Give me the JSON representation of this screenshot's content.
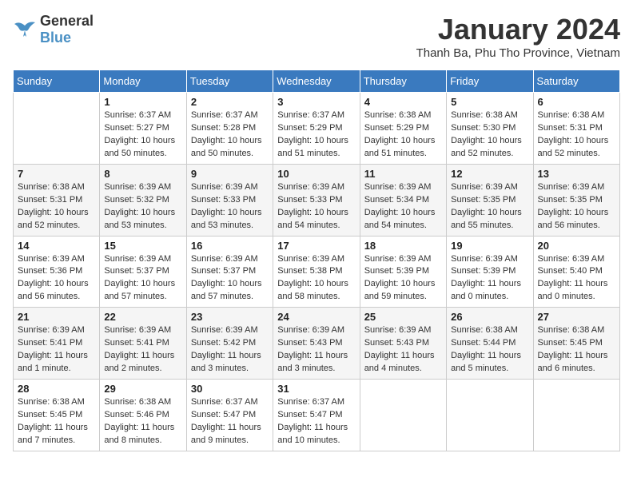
{
  "header": {
    "logo_line1": "General",
    "logo_line2": "Blue",
    "month": "January 2024",
    "location": "Thanh Ba, Phu Tho Province, Vietnam"
  },
  "weekdays": [
    "Sunday",
    "Monday",
    "Tuesday",
    "Wednesday",
    "Thursday",
    "Friday",
    "Saturday"
  ],
  "weeks": [
    [
      {
        "day": "",
        "text": ""
      },
      {
        "day": "1",
        "text": "Sunrise: 6:37 AM\nSunset: 5:27 PM\nDaylight: 10 hours\nand 50 minutes."
      },
      {
        "day": "2",
        "text": "Sunrise: 6:37 AM\nSunset: 5:28 PM\nDaylight: 10 hours\nand 50 minutes."
      },
      {
        "day": "3",
        "text": "Sunrise: 6:37 AM\nSunset: 5:29 PM\nDaylight: 10 hours\nand 51 minutes."
      },
      {
        "day": "4",
        "text": "Sunrise: 6:38 AM\nSunset: 5:29 PM\nDaylight: 10 hours\nand 51 minutes."
      },
      {
        "day": "5",
        "text": "Sunrise: 6:38 AM\nSunset: 5:30 PM\nDaylight: 10 hours\nand 52 minutes."
      },
      {
        "day": "6",
        "text": "Sunrise: 6:38 AM\nSunset: 5:31 PM\nDaylight: 10 hours\nand 52 minutes."
      }
    ],
    [
      {
        "day": "7",
        "text": "Sunrise: 6:38 AM\nSunset: 5:31 PM\nDaylight: 10 hours\nand 52 minutes."
      },
      {
        "day": "8",
        "text": "Sunrise: 6:39 AM\nSunset: 5:32 PM\nDaylight: 10 hours\nand 53 minutes."
      },
      {
        "day": "9",
        "text": "Sunrise: 6:39 AM\nSunset: 5:33 PM\nDaylight: 10 hours\nand 53 minutes."
      },
      {
        "day": "10",
        "text": "Sunrise: 6:39 AM\nSunset: 5:33 PM\nDaylight: 10 hours\nand 54 minutes."
      },
      {
        "day": "11",
        "text": "Sunrise: 6:39 AM\nSunset: 5:34 PM\nDaylight: 10 hours\nand 54 minutes."
      },
      {
        "day": "12",
        "text": "Sunrise: 6:39 AM\nSunset: 5:35 PM\nDaylight: 10 hours\nand 55 minutes."
      },
      {
        "day": "13",
        "text": "Sunrise: 6:39 AM\nSunset: 5:35 PM\nDaylight: 10 hours\nand 56 minutes."
      }
    ],
    [
      {
        "day": "14",
        "text": "Sunrise: 6:39 AM\nSunset: 5:36 PM\nDaylight: 10 hours\nand 56 minutes."
      },
      {
        "day": "15",
        "text": "Sunrise: 6:39 AM\nSunset: 5:37 PM\nDaylight: 10 hours\nand 57 minutes."
      },
      {
        "day": "16",
        "text": "Sunrise: 6:39 AM\nSunset: 5:37 PM\nDaylight: 10 hours\nand 57 minutes."
      },
      {
        "day": "17",
        "text": "Sunrise: 6:39 AM\nSunset: 5:38 PM\nDaylight: 10 hours\nand 58 minutes."
      },
      {
        "day": "18",
        "text": "Sunrise: 6:39 AM\nSunset: 5:39 PM\nDaylight: 10 hours\nand 59 minutes."
      },
      {
        "day": "19",
        "text": "Sunrise: 6:39 AM\nSunset: 5:39 PM\nDaylight: 11 hours\nand 0 minutes."
      },
      {
        "day": "20",
        "text": "Sunrise: 6:39 AM\nSunset: 5:40 PM\nDaylight: 11 hours\nand 0 minutes."
      }
    ],
    [
      {
        "day": "21",
        "text": "Sunrise: 6:39 AM\nSunset: 5:41 PM\nDaylight: 11 hours\nand 1 minute."
      },
      {
        "day": "22",
        "text": "Sunrise: 6:39 AM\nSunset: 5:41 PM\nDaylight: 11 hours\nand 2 minutes."
      },
      {
        "day": "23",
        "text": "Sunrise: 6:39 AM\nSunset: 5:42 PM\nDaylight: 11 hours\nand 3 minutes."
      },
      {
        "day": "24",
        "text": "Sunrise: 6:39 AM\nSunset: 5:43 PM\nDaylight: 11 hours\nand 3 minutes."
      },
      {
        "day": "25",
        "text": "Sunrise: 6:39 AM\nSunset: 5:43 PM\nDaylight: 11 hours\nand 4 minutes."
      },
      {
        "day": "26",
        "text": "Sunrise: 6:38 AM\nSunset: 5:44 PM\nDaylight: 11 hours\nand 5 minutes."
      },
      {
        "day": "27",
        "text": "Sunrise: 6:38 AM\nSunset: 5:45 PM\nDaylight: 11 hours\nand 6 minutes."
      }
    ],
    [
      {
        "day": "28",
        "text": "Sunrise: 6:38 AM\nSunset: 5:45 PM\nDaylight: 11 hours\nand 7 minutes."
      },
      {
        "day": "29",
        "text": "Sunrise: 6:38 AM\nSunset: 5:46 PM\nDaylight: 11 hours\nand 8 minutes."
      },
      {
        "day": "30",
        "text": "Sunrise: 6:37 AM\nSunset: 5:47 PM\nDaylight: 11 hours\nand 9 minutes."
      },
      {
        "day": "31",
        "text": "Sunrise: 6:37 AM\nSunset: 5:47 PM\nDaylight: 11 hours\nand 10 minutes."
      },
      {
        "day": "",
        "text": ""
      },
      {
        "day": "",
        "text": ""
      },
      {
        "day": "",
        "text": ""
      }
    ]
  ]
}
